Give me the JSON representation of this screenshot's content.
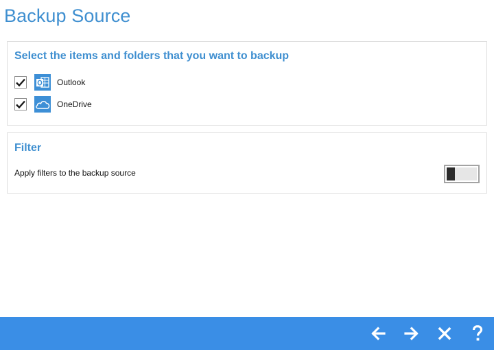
{
  "header": {
    "title": "Backup Source"
  },
  "source_panel": {
    "heading": "Select the items and folders that you want to backup",
    "items": [
      {
        "label": "Outlook",
        "checked": true,
        "icon": "outlook-icon"
      },
      {
        "label": "OneDrive",
        "checked": true,
        "icon": "onedrive-icon"
      }
    ]
  },
  "filter_panel": {
    "heading": "Filter",
    "description": "Apply filters to the backup source",
    "toggle_on": false
  },
  "footer": {
    "buttons": [
      {
        "icon": "arrow-left-icon"
      },
      {
        "icon": "arrow-right-icon"
      },
      {
        "icon": "close-icon"
      },
      {
        "icon": "help-icon"
      }
    ]
  },
  "colors": {
    "accent": "#3f8fd0",
    "footer": "#3a8ee6",
    "icon_bg": "#3d8fd6"
  }
}
